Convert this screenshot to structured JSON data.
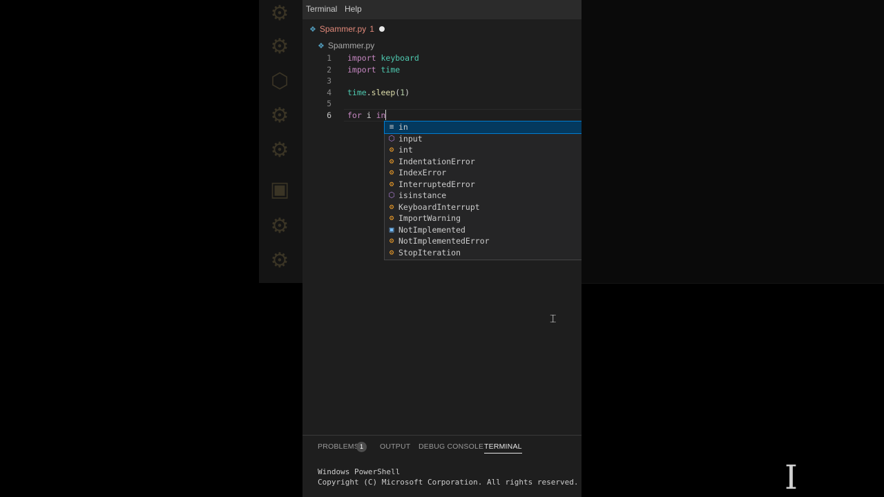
{
  "menu": [
    "Terminal",
    "Help"
  ],
  "tab": {
    "label": "Spammer.py",
    "problem_count": "1"
  },
  "breadcrumb": "Spammer.py",
  "code_lines": [
    {
      "n": "1",
      "tokens": [
        [
          "kw",
          "import "
        ],
        [
          "mod",
          "keyboard"
        ]
      ]
    },
    {
      "n": "2",
      "tokens": [
        [
          "kw",
          "import "
        ],
        [
          "mod",
          "time"
        ]
      ]
    },
    {
      "n": "3",
      "tokens": []
    },
    {
      "n": "4",
      "tokens": [
        [
          "mod",
          "time"
        ],
        [
          "txt",
          "."
        ],
        [
          "fn",
          "sleep"
        ],
        [
          "txt",
          "("
        ],
        [
          "num",
          "1"
        ],
        [
          "txt",
          ")"
        ]
      ]
    },
    {
      "n": "5",
      "tokens": []
    },
    {
      "n": "6",
      "tokens": [
        [
          "kw",
          "for "
        ],
        [
          "txt",
          "i "
        ],
        [
          "kw",
          "in"
        ]
      ]
    }
  ],
  "suggestions": [
    {
      "kind": "keyword",
      "icon": "keyword-icon",
      "label": "in"
    },
    {
      "kind": "function",
      "icon": "function-icon",
      "label": "input"
    },
    {
      "kind": "class",
      "icon": "class-icon",
      "label": "int"
    },
    {
      "kind": "class",
      "icon": "class-icon",
      "label": "IndentationError"
    },
    {
      "kind": "class",
      "icon": "class-icon",
      "label": "IndexError"
    },
    {
      "kind": "class",
      "icon": "class-icon",
      "label": "InterruptedError"
    },
    {
      "kind": "function",
      "icon": "function-icon",
      "label": "isinstance"
    },
    {
      "kind": "class",
      "icon": "class-icon",
      "label": "KeyboardInterrupt"
    },
    {
      "kind": "class",
      "icon": "class-icon",
      "label": "ImportWarning"
    },
    {
      "kind": "constant",
      "icon": "constant-icon",
      "label": "NotImplemented"
    },
    {
      "kind": "class",
      "icon": "class-icon",
      "label": "NotImplementedError"
    },
    {
      "kind": "class",
      "icon": "class-icon",
      "label": "StopIteration"
    }
  ],
  "panel": {
    "tabs": [
      "PROBLEMS",
      "OUTPUT",
      "DEBUG CONSOLE",
      "TERMINAL"
    ],
    "problems_badge": "1",
    "terminal_lines": [
      "Windows PowerShell",
      "Copyright (C) Microsoft Corporation. All rights reserved."
    ]
  },
  "colors": {
    "keyword": "#c586c0",
    "module": "#4ec9b0",
    "function": "#dcdcaa",
    "number": "#b5cea8",
    "selection": "#04395e"
  }
}
